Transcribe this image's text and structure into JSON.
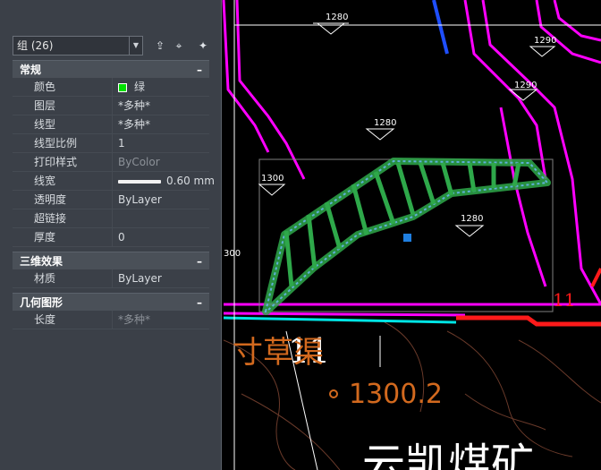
{
  "properties": {
    "selection": "组 (26)",
    "sections": [
      {
        "title": "常规",
        "collapse": "–",
        "rows": [
          {
            "key": "颜色",
            "value": "绿",
            "swatch": true
          },
          {
            "key": "图层",
            "value": "*多种*"
          },
          {
            "key": "线型",
            "value": "*多种*"
          },
          {
            "key": "线型比例",
            "value": "1"
          },
          {
            "key": "打印样式",
            "value": "ByColor",
            "dim": true
          },
          {
            "key": "线宽",
            "value": "0.60 mm",
            "lineweight": true
          },
          {
            "key": "透明度",
            "value": "ByLayer"
          },
          {
            "key": "超链接",
            "value": ""
          },
          {
            "key": "厚度",
            "value": "0"
          }
        ]
      },
      {
        "title": "三维效果",
        "collapse": "–",
        "rows": [
          {
            "key": "材质",
            "value": "ByLayer"
          }
        ]
      },
      {
        "title": "几何图形",
        "collapse": "–",
        "rows": [
          {
            "key": "长度",
            "value": "*多种*",
            "dim": true
          }
        ]
      }
    ]
  },
  "drawing": {
    "elevation_labels": [
      "1280",
      "1300",
      "1290",
      "1280",
      "1300",
      "1280",
      "300"
    ],
    "section_mark_a": "1",
    "section_mark_b": "1",
    "road_label": "寸草渠",
    "spot_elevation": "1300.2",
    "mine_label": "云凯煤矿",
    "section_right": "11"
  },
  "icons": {
    "quick_select": "quick-select-icon",
    "select_objects": "select-objects-icon",
    "toggle_pickadd": "toggle-pickadd-icon"
  },
  "colors": {
    "contour": "#ff00ff",
    "selection": "#2ea84a",
    "grip": "#1f7fe0",
    "text_orange": "#d2691e"
  }
}
